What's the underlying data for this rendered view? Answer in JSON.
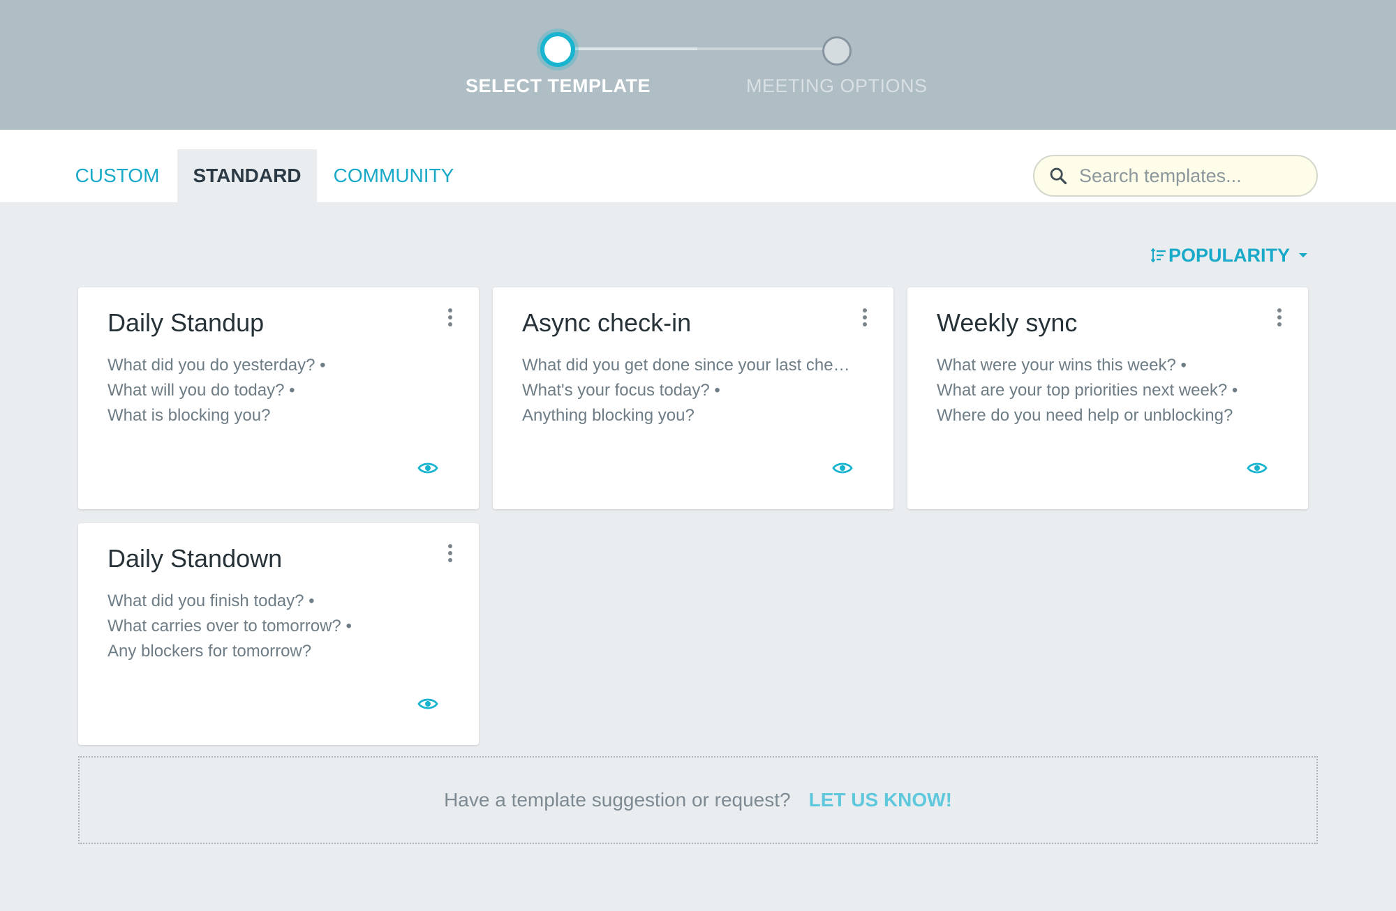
{
  "stepper": {
    "steps": [
      {
        "label": "SELECT TEMPLATE",
        "state": "active"
      },
      {
        "label": "MEETING OPTIONS",
        "state": "inactive"
      }
    ],
    "accent_color": "#19b4cf"
  },
  "tabs": [
    {
      "label": "CUSTOM",
      "selected": false
    },
    {
      "label": "STANDARD",
      "selected": true
    },
    {
      "label": "COMMUNITY",
      "selected": false
    }
  ],
  "search": {
    "placeholder": "Search templates...",
    "value": "",
    "icon": "search-icon"
  },
  "sort": {
    "label": "POPULARITY",
    "icon": "sort-icon"
  },
  "templates": [
    {
      "title": "Daily Standup",
      "prompts": [
        "What did you do yesterday? •",
        "What will you do today? •",
        "What is blocking you?"
      ]
    },
    {
      "title": "Async check-in",
      "prompts": [
        "What did you get done since your last che…",
        "What's your focus today? •",
        "Anything blocking you?"
      ]
    },
    {
      "title": "Weekly sync",
      "prompts": [
        "What were your wins this week? •",
        "What are your top priorities next week? •",
        "Where do you need help or unblocking?"
      ]
    },
    {
      "title": "Daily Standown",
      "prompts": [
        "What did you finish today? •",
        "What carries over to tomorrow? •",
        "Any blockers for tomorrow?"
      ]
    }
  ],
  "suggestion": {
    "text": "Have a template suggestion or request?",
    "link": "LET US KNOW!"
  },
  "colors": {
    "header_bg": "#afbdc4",
    "page_bg": "#eaedf0",
    "link": "#19a9c8"
  }
}
